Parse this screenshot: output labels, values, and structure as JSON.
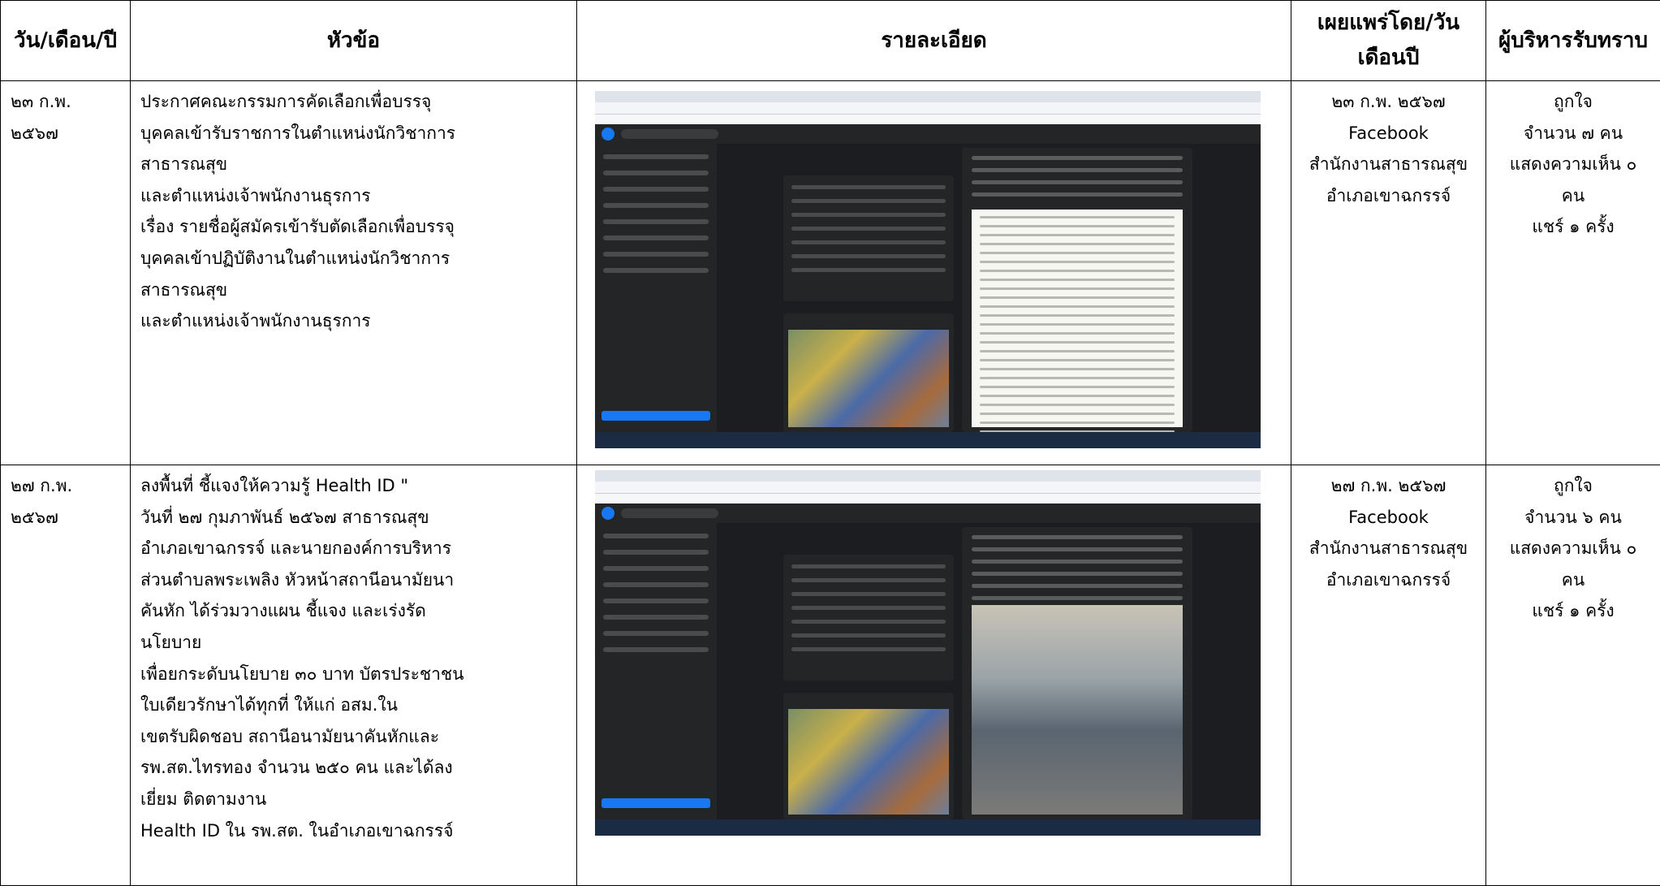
{
  "headers": {
    "date": "วัน/เดือน/ปี",
    "topic": "หัวข้อ",
    "details": "รายละเอียด",
    "published": "เผยแพร่โดย/วันเดือนปี",
    "ack": "ผู้บริหารรับทราบ"
  },
  "rows": [
    {
      "date": "๒๓ ก.พ. ๒๕๖๗",
      "topic": [
        "ประกาศคณะกรรมการคัดเลือกเพื่อบรรจุ",
        "บุคคลเข้ารับราชการในตำแหน่งนักวิชาการ",
        "สาธารณสุข",
        "และตำแหน่งเจ้าพนักงานธุรการ",
        "เรื่อง รายชื่อผู้สมัครเข้ารับตัดเลือกเพื่อบรรจุ",
        "บุคคลเข้าปฏิบัติงานในตำแหน่งนักวิชาการ",
        "สาธารณสุข",
        "และตำแหน่งเจ้าพนักงานธุรการ"
      ],
      "published": [
        "๒๓ ก.พ. ๒๕๖๗",
        "Facebook",
        "สำนักงานสาธารณสุข",
        "อำเภอเขาฉกรรจ์"
      ],
      "ack": [
        "ถูกใจ",
        "จำนวน ๗ คน",
        "แสดงความเห็น ๐",
        "คน",
        "แชร์ ๑ ครั้ง"
      ]
    },
    {
      "date": "๒๗ ก.พ. ๒๕๖๗",
      "topic": [
        " ลงพื้นที่ ชี้แจงให้ความรู้ Health ID \"",
        "วันที่ ๒๗ กุมภาพันธ์ ๒๕๖๗ สาธารณสุข",
        "อำเภอเขาฉกรรจ์ และนายกองค์การบริหาร",
        "ส่วนตำบลพระเพลิง หัวหน้าสถานีอนามัยนา",
        "คันหัก ได้ร่วมวางแผน ชี้แจง และเร่งรัด",
        "นโยบาย",
        "เพื่อยกระดับนโยบาย ๓๐ บาท บัตรประชาชน",
        "ใบเดียวรักษาได้ทุกที่ ให้แก่ อสม.ใน",
        " เขตรับผิดชอบ สถานีอนามัยนาคันหักและ",
        "รพ.สต.ไทรทอง จำนวน ๒๕๐ คน  และได้ลง",
        "เยี่ยม ติดตามงาน",
        " Health ID ใน รพ.สต. ในอำเภอเขาฉกรรจ์"
      ],
      "published": [
        "๒๗ ก.พ. ๒๕๖๗",
        "Facebook",
        "สำนักงานสาธารณสุข",
        "อำเภอเขาฉกรรจ์"
      ],
      "ack": [
        "ถูกใจ",
        "จำนวน ๖ คน",
        "แสดงความเห็น ๐",
        "คน",
        "แชร์ ๑ ครั้ง"
      ]
    }
  ]
}
